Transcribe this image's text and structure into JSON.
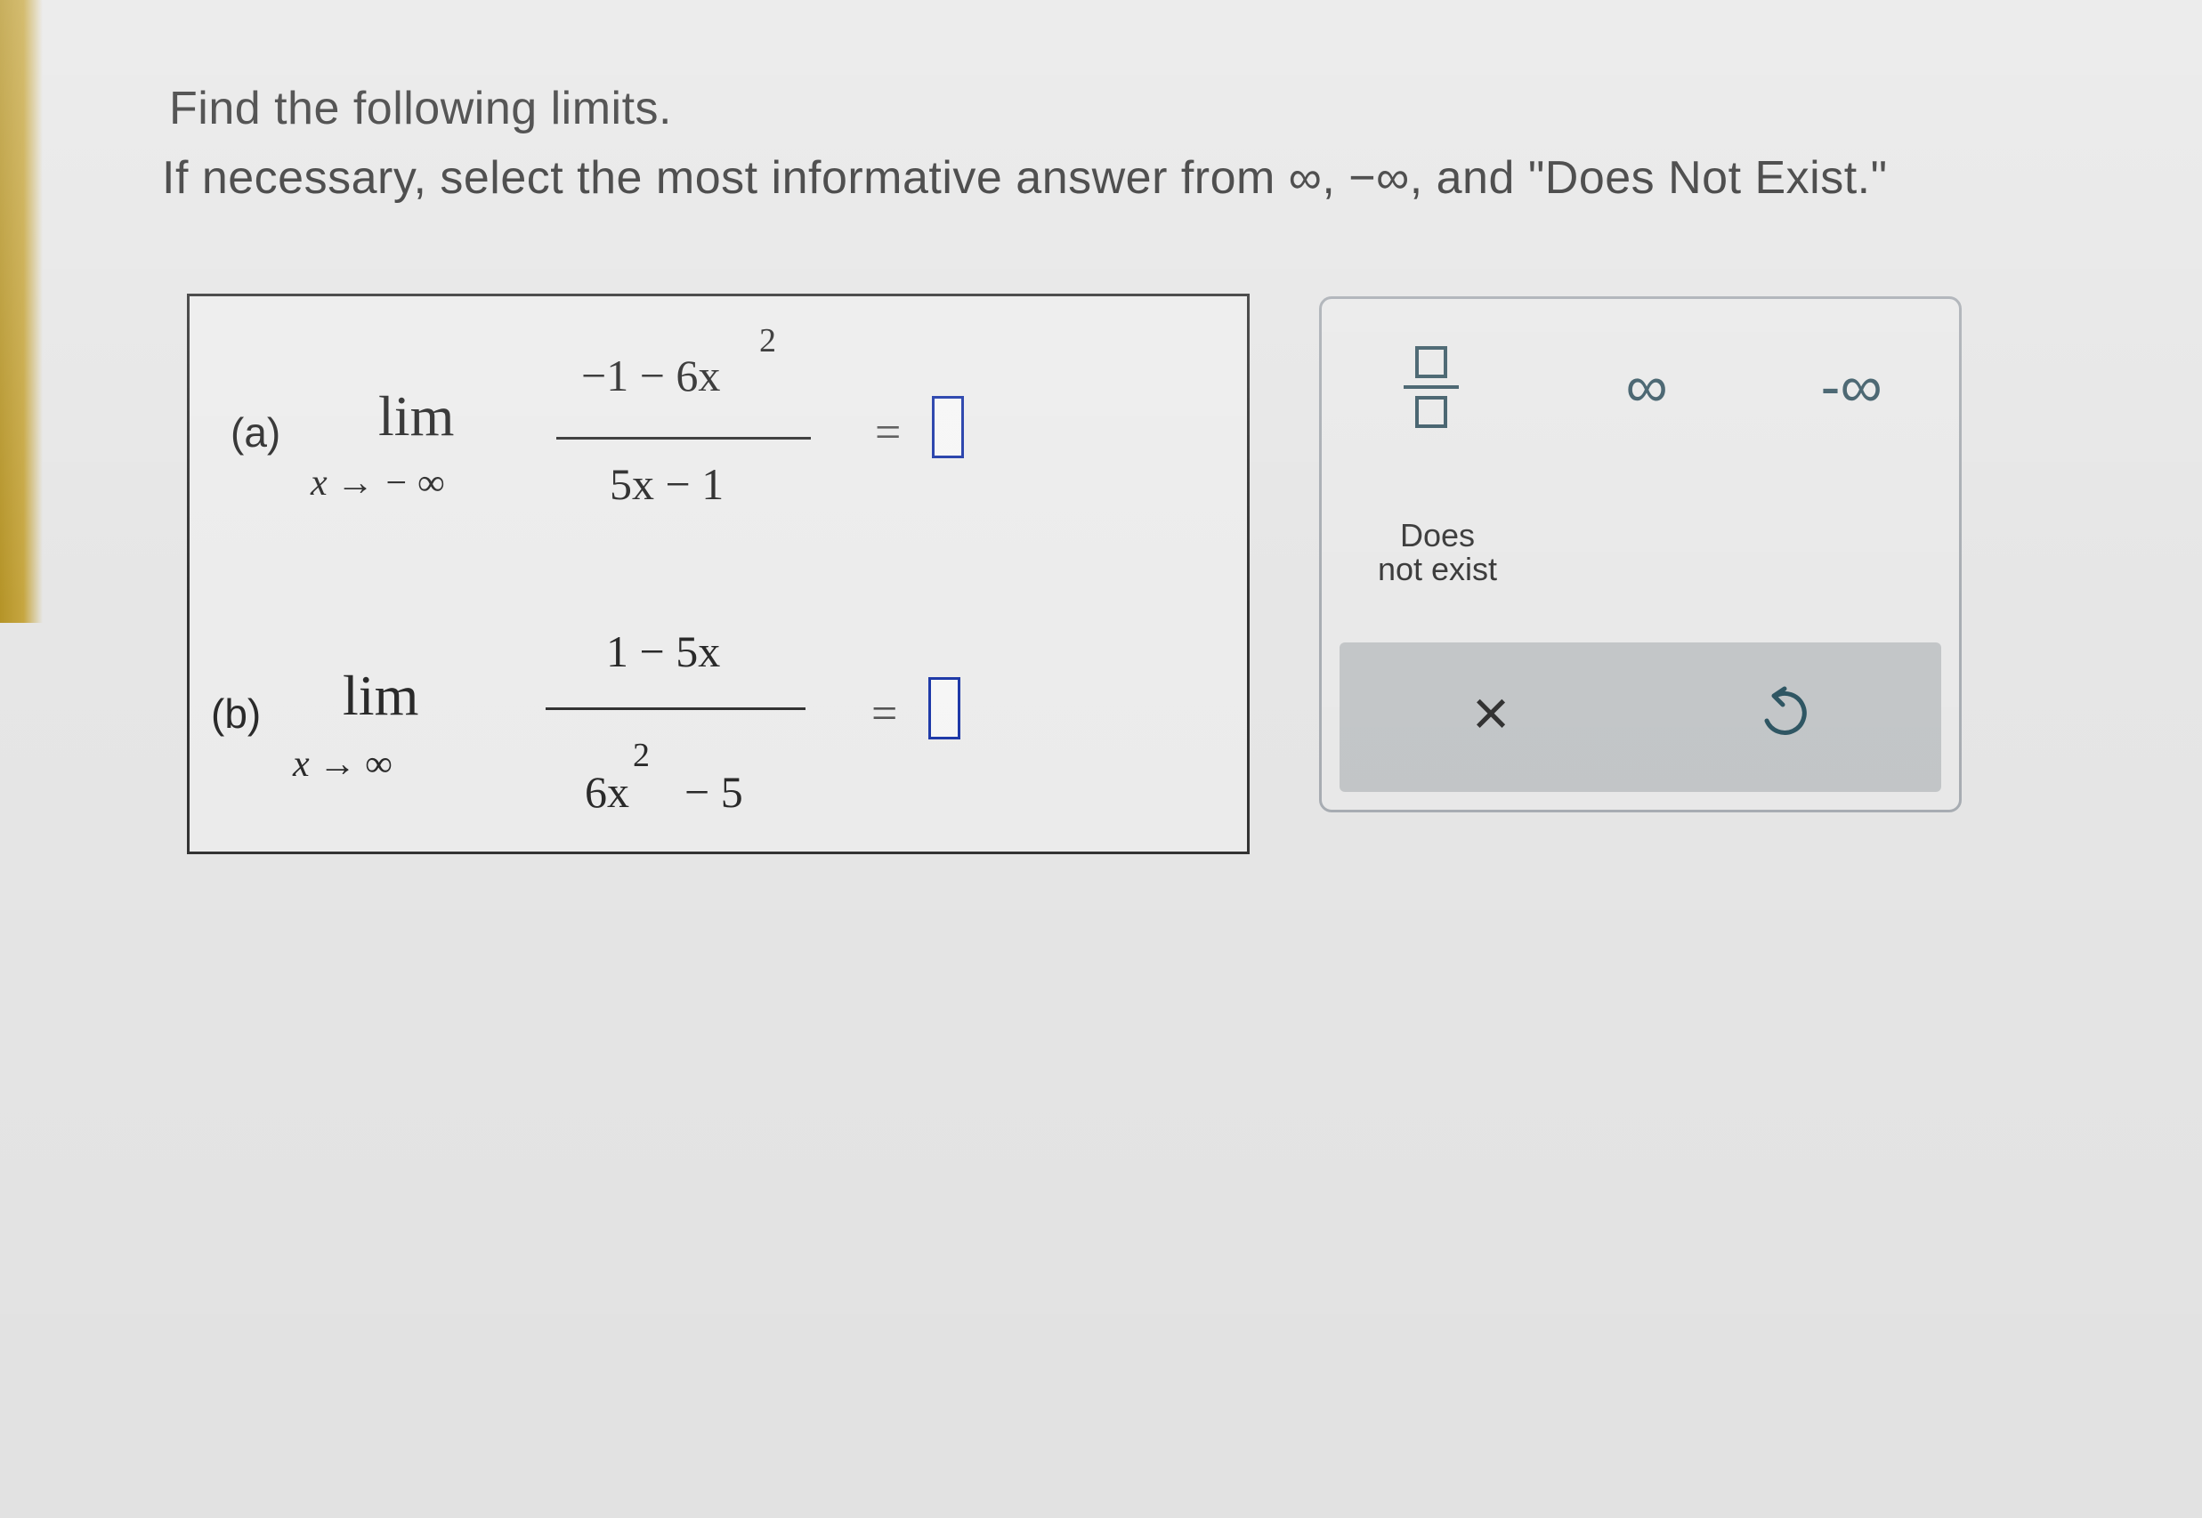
{
  "prompt": {
    "line1": "Find the following limits.",
    "line2": "If necessary, select the most informative answer from ∞, −∞, and \"Does Not Exist.\""
  },
  "problems": {
    "a": {
      "label": "(a)",
      "lim": "lim",
      "approach": "x → − ∞",
      "numerator": "−1 − 6x",
      "numerator_exp": "2",
      "denominator": "5x − 1",
      "equals": "="
    },
    "b": {
      "label": "(b)",
      "lim": "lim",
      "approach": "x → ∞",
      "numerator": "1 − 5x",
      "denominator": "6x",
      "denominator_exp": "2",
      "denominator_rest": "− 5",
      "equals": "="
    }
  },
  "keypad": {
    "infinity": "∞",
    "neg_infinity": "-∞",
    "dne_line1": "Does",
    "dne_line2": "not exist",
    "clear": "×",
    "icons": {
      "fraction": "fraction-icon",
      "undo": "undo-icon"
    }
  },
  "colors": {
    "answer_box_border": "#1f3aa8",
    "keypad_icon": "#3c5a66",
    "action_bar": "#c3c6c8"
  }
}
